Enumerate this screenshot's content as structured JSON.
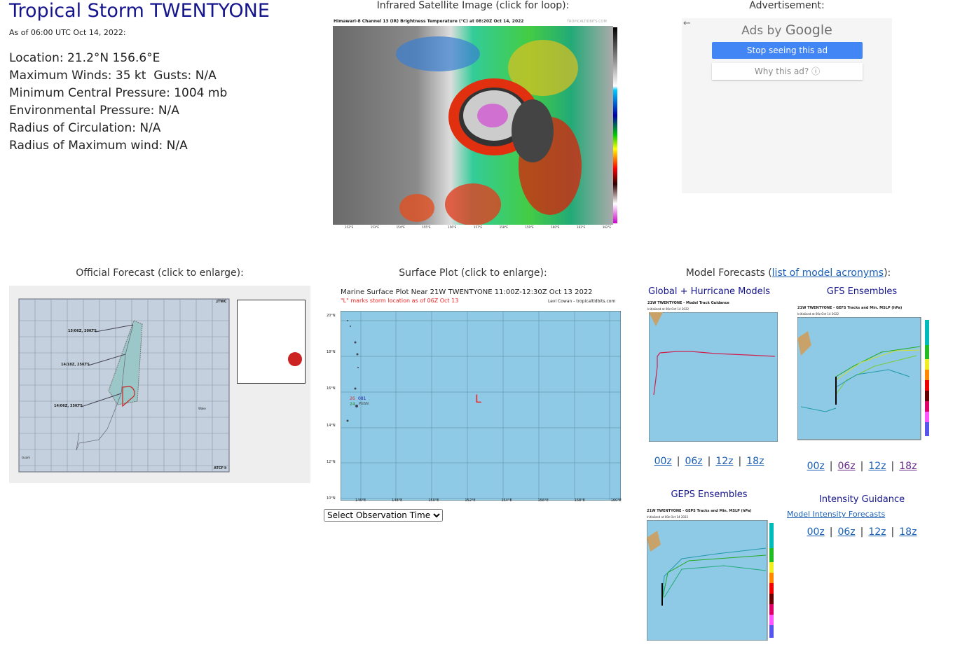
{
  "storm": {
    "title": "Tropical Storm TWENTYONE",
    "as_of": "As of 06:00 UTC Oct 14, 2022:",
    "info": [
      "Location: 21.2°N 156.6°E",
      "Maximum Winds: 35 kt  Gusts: N/A",
      "Minimum Central Pressure: 1004 mb",
      "Environmental Pressure: N/A",
      "Radius of Circulation: N/A",
      "Radius of Maximum wind: N/A"
    ]
  },
  "satellite": {
    "heading": "Infrared Satellite Image (click for loop):",
    "image_title": "Himawari-8 Channel 13 (IR) Brightness Temperature (°C) at 08:20Z Oct 14, 2022",
    "watermark": "TROPICALTIDBITS.COM",
    "lon_ticks": [
      "152°E",
      "153°E",
      "154°E",
      "155°E",
      "156°E",
      "157°E",
      "158°E",
      "159°E",
      "160°E",
      "161°E",
      "162°E"
    ],
    "lat_ticks": [
      "26°N",
      "25°N",
      "24°N",
      "23°N",
      "22°N",
      "21°N",
      "20°N",
      "19°N"
    ],
    "scale_ticks": [
      "40",
      "20",
      "0",
      "-20",
      "-30",
      "-40",
      "-50",
      "-60",
      "-70",
      "-80",
      "-90"
    ]
  },
  "ad": {
    "heading": "Advertisement:",
    "ads_by": "Ads by",
    "google": "Google",
    "stop": "Stop seeing this ad",
    "why": "Why this ad? ⓘ",
    "back_icon": "arrow-left"
  },
  "official": {
    "heading": "Official Forecast (click to enlarge):",
    "labels": [
      "15/06Z, 20KTS",
      "14/18Z, 25KTS",
      "14/06Z, 35KTS"
    ],
    "jtwc": "JTWC",
    "atcf": "ATCF®",
    "wake": "Wake",
    "guam": "Guam"
  },
  "surface": {
    "heading": "Surface Plot (click to enlarge):",
    "image_title": "Marine Surface Plot Near 21W TWENTYONE 11:00Z-12:30Z Oct 13 2022",
    "image_subtitle": "\"L\" marks storm location as of 06Z Oct 13",
    "credit": "Levi Cowan - tropicaltidbits.com",
    "storm_marker": "L",
    "lat_ticks": [
      "20°N",
      "18°N",
      "16°N",
      "14°N",
      "12°N",
      "10°N"
    ],
    "lon_ticks": [
      "146°E",
      "148°E",
      "150°E",
      "152°E",
      "154°E",
      "156°E",
      "158°E",
      "160°E"
    ],
    "station": [
      "26",
      "081",
      "24",
      "PGSN"
    ],
    "select": "Select Observation Time..."
  },
  "models": {
    "heading_prefix": "Model Forecasts (",
    "heading_link": "list of model acronyms",
    "heading_suffix": "):",
    "global": {
      "heading": "Global + Hurricane Models",
      "image_title": "21W TWENTYONE - Model Track Guidance",
      "init": "Initialized at 00z Oct 14 2022",
      "links": [
        "00z",
        "06z",
        "12z",
        "18z"
      ]
    },
    "gfs": {
      "heading": "GFS Ensembles",
      "image_title": "21W TWENTYONE - GEFS Tracks and Min. MSLP (hPa)",
      "init": "Initialized at 00z Oct 14 2022",
      "links": [
        "00z",
        "06z",
        "12z",
        "18z"
      ]
    },
    "geps": {
      "heading": "GEPS Ensembles",
      "image_title": "21W TWENTYONE - GEPS Tracks and Min. MSLP (hPa)",
      "init": "Initialized at 00z Oct 14 2022"
    },
    "intensity": {
      "heading": "Intensity Guidance",
      "link": "Model Intensity Forecasts",
      "links": [
        "00z",
        "06z",
        "12z",
        "18z"
      ]
    }
  },
  "colors": {
    "title": "#14148c",
    "link": "#1a5fb4",
    "visited": "#6a2a8a",
    "ocean": "#8ecae6",
    "ad_button": "#4285f4"
  }
}
